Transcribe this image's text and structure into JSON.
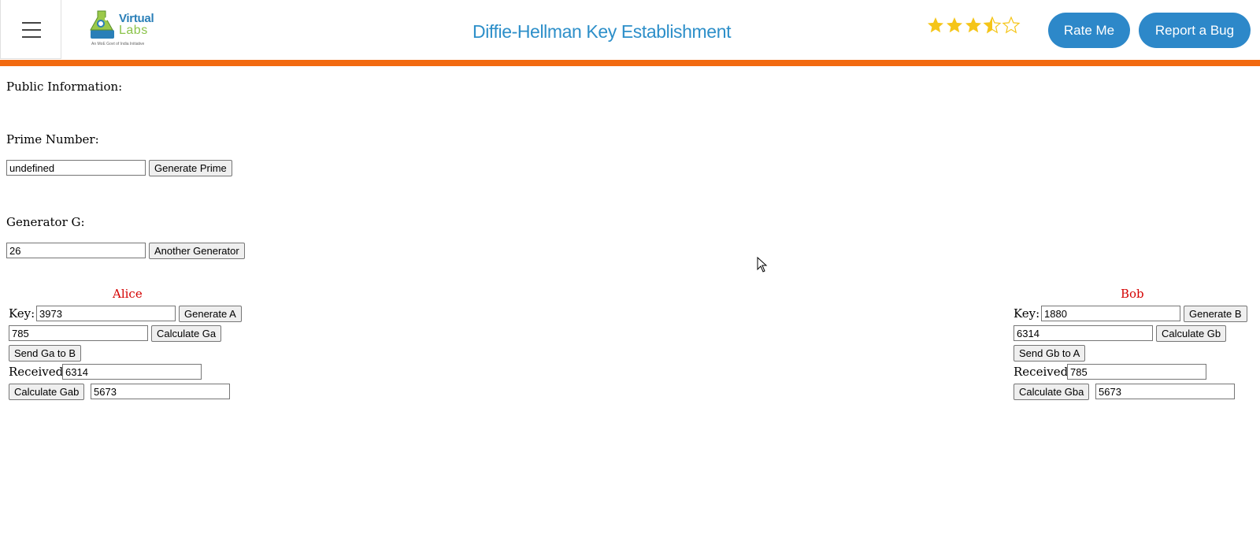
{
  "header": {
    "logo_line1": "Virtual",
    "logo_line2": "Labs",
    "logo_sub": "An MoE Govt of India Initiative",
    "title": "Diffie-Hellman Key Establishment",
    "rating": 3.5,
    "rate_label": "Rate Me",
    "bug_label": "Report a Bug"
  },
  "public": {
    "heading": "Public Information:",
    "prime_label": "Prime Number:",
    "prime_value": "undefined",
    "prime_button": "Generate Prime",
    "generator_label": "Generator G:",
    "generator_value": "26",
    "generator_button": "Another Generator"
  },
  "alice": {
    "name": "Alice",
    "key_label": "Key:",
    "key_value": "3973",
    "generate_button": "Generate A",
    "ga_value": "785",
    "calc_button": "Calculate Ga",
    "send_button": "Send Ga to B",
    "received_label": "Received:",
    "received_value": "6314",
    "shared_button": "Calculate Gab",
    "shared_value": "5673"
  },
  "bob": {
    "name": "Bob",
    "key_label": "Key:",
    "key_value": "1880",
    "generate_button": "Generate B",
    "gb_value": "6314",
    "calc_button": "Calculate Gb",
    "send_button": "Send Gb to A",
    "received_label": "Received:",
    "received_value": "785",
    "shared_button": "Calculate Gba",
    "shared_value": "5673"
  },
  "colors": {
    "accent": "#2d88c9",
    "orange_bar": "#f26a10",
    "party_name": "#d40000",
    "star": "#f5c518"
  }
}
